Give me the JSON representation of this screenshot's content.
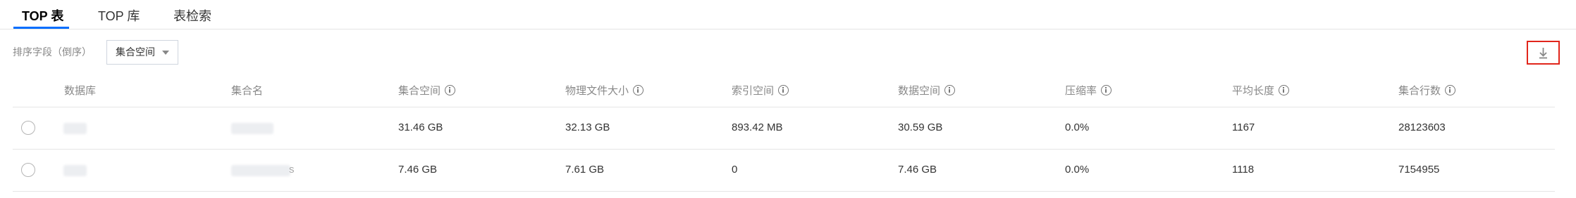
{
  "tabs": [
    {
      "label": "TOP 表",
      "active": true
    },
    {
      "label": "TOP 库",
      "active": false
    },
    {
      "label": "表检索",
      "active": false
    }
  ],
  "filter": {
    "label": "排序字段（倒序）",
    "selected": "集合空间"
  },
  "toolbar": {
    "download_icon": "download-icon",
    "download_highlight_color": "#e1251b"
  },
  "table": {
    "headers": [
      "数据库",
      "集合名",
      "集合空间",
      "物理文件大小",
      "索引空间",
      "数据空间",
      "压缩率",
      "平均长度",
      "集合行数"
    ],
    "rows": [
      {
        "database": "",
        "collection": "",
        "collection_space": "31.46 GB",
        "physical_size": "32.13 GB",
        "index_space": "893.42 MB",
        "data_space": "30.59 GB",
        "compression": "0.0%",
        "avg_length": "1167",
        "row_count": "28123603"
      },
      {
        "database": "",
        "collection": "s",
        "collection_space": "7.46 GB",
        "physical_size": "7.61 GB",
        "index_space": "0",
        "data_space": "7.46 GB",
        "compression": "0.0%",
        "avg_length": "1118",
        "row_count": "7154955"
      }
    ]
  }
}
